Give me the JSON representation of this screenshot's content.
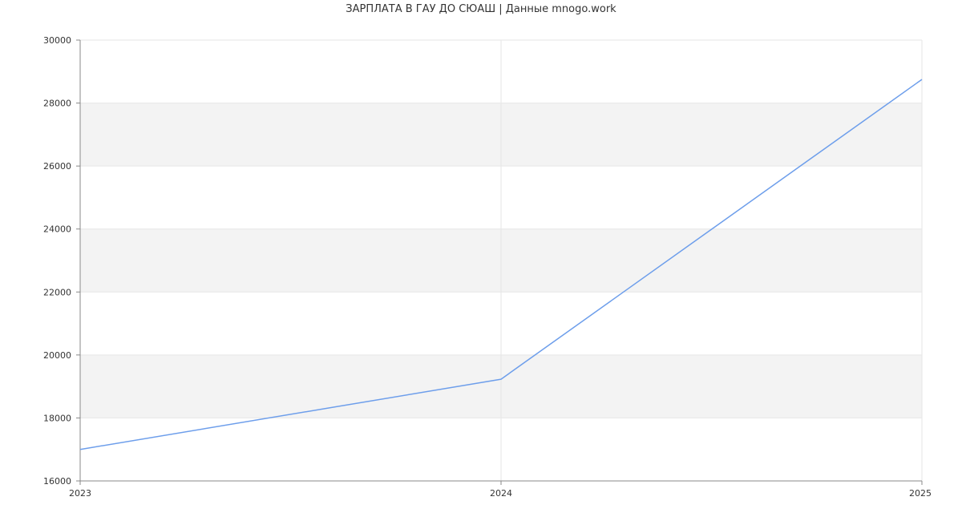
{
  "chart_data": {
    "type": "line",
    "title": "ЗАРПЛАТА В ГАУ ДО СЮАШ | Данные mnogo.work",
    "xlabel": "",
    "ylabel": "",
    "x": [
      "2023",
      "2024",
      "2025"
    ],
    "series": [
      {
        "values": [
          17000,
          19230,
          28750
        ]
      }
    ],
    "ylim": [
      16000,
      30000
    ],
    "yticks": [
      "16000",
      "18000",
      "20000",
      "22000",
      "24000",
      "26000",
      "28000",
      "30000"
    ],
    "grid": true,
    "legend": "none",
    "colors": {
      "line": "#6d9eeb",
      "band": "#f3f3f3",
      "grid": "#e6e6e6",
      "axis": "#888888",
      "text": "#333333"
    }
  }
}
